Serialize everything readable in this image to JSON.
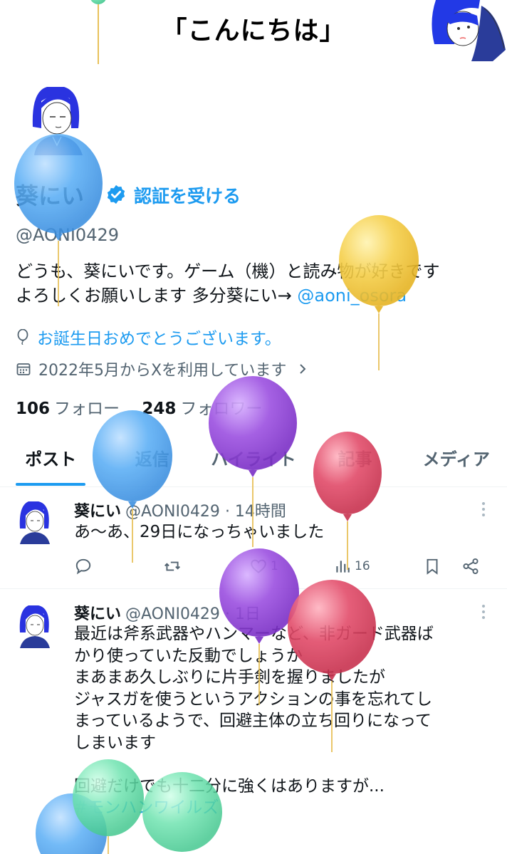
{
  "caption": "「こんにちは」",
  "profile": {
    "display_name": "葵にい",
    "verify_label": "認証を受ける",
    "handle": "@AONI0429",
    "bio_line1": "どうも、葵にいです。ゲーム（機）と読み物が好きです",
    "bio_line2_prefix": "よろしくお願いします 多分葵にい→ ",
    "bio_mention": "@aoni_osora",
    "birthday": "お誕生日おめでとうございます。",
    "joined": "2022年5月からXを利用しています",
    "following_count": "106",
    "following_label": "フォロー",
    "followers_count": "248",
    "followers_label": "フォロワー"
  },
  "tabs": [
    {
      "label": "ポスト",
      "active": true
    },
    {
      "label": "返信",
      "active": false
    },
    {
      "label": "ハイライト",
      "active": false
    },
    {
      "label": "記事",
      "active": false
    },
    {
      "label": "メディア",
      "active": false
    }
  ],
  "posts": [
    {
      "name": "葵にい",
      "handle": "@AONI0429",
      "time": "· 14時間",
      "text": "あ〜あ、29日になっちゃいました",
      "likes": "1",
      "views": "16"
    },
    {
      "name": "葵にい",
      "handle": "@AONI0429",
      "time": "· 1日",
      "lines": [
        "最近は斧系武器やハンマーなど、非ガード武器ば",
        "かり使っていた反動でしょうか",
        "まあまあ久しぶりに片手剣を握りましたが",
        "ジャスガを使うというアクションの事を忘れてし",
        "まっているようで、回避主体の立ち回りになって",
        "しまいます",
        "",
        "回避だけでも十二分に強くはありますが..."
      ],
      "hashtag": "#モンハンワイルズ"
    }
  ],
  "colors": {
    "accent": "#1d9bf0",
    "text": "#0f1419",
    "secondary": "#536471",
    "balloon_blue": "#5aaef5",
    "balloon_yellow": "#f5cf4a",
    "balloon_purple": "#9b4fe0",
    "balloon_red": "#e24c6a",
    "balloon_green": "#6fe3b0"
  }
}
